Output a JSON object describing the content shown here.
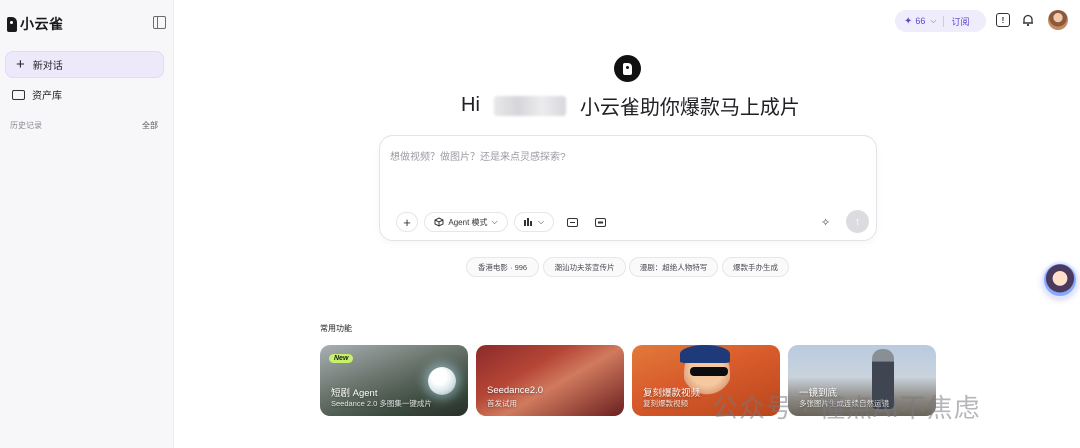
{
  "app": {
    "name": "小云雀"
  },
  "sidebar": {
    "new_chat_label": "新对话",
    "assets_label": "资产库",
    "history_label": "历史记录",
    "history_all_label": "全部"
  },
  "topbar": {
    "credits_value": "66",
    "subscribe_label": "订阅",
    "accent_color": "#5b4bd6"
  },
  "hero": {
    "greeting_prefix": "Hi",
    "tagline": "小云雀助你爆款马上成片"
  },
  "prompt": {
    "placeholder": "想做视频？做图片？还是来点灵感探索?",
    "agent_mode_label": "Agent 模式"
  },
  "suggestions": [
    {
      "label": "香港电影 · 996"
    },
    {
      "label": "潮汕功夫茶宣传片"
    },
    {
      "label": "漫剧：超绝人物特写"
    },
    {
      "label": "爆款手办生成"
    }
  ],
  "features": {
    "section_label": "常用功能",
    "cards": [
      {
        "badge": "New",
        "title": "短剧 Agent",
        "subtitle": "Seedance 2.0 多图集一键成片"
      },
      {
        "title": "Seedance2.0",
        "subtitle": "首发试用"
      },
      {
        "title": "复刻爆款视频",
        "subtitle": "复刻爆款视频"
      },
      {
        "title": "一镜到底",
        "subtitle": "多张图片生成连续自然运镜"
      }
    ]
  },
  "watermark": {
    "text": "公众号 · 懂点AI不焦虑"
  }
}
